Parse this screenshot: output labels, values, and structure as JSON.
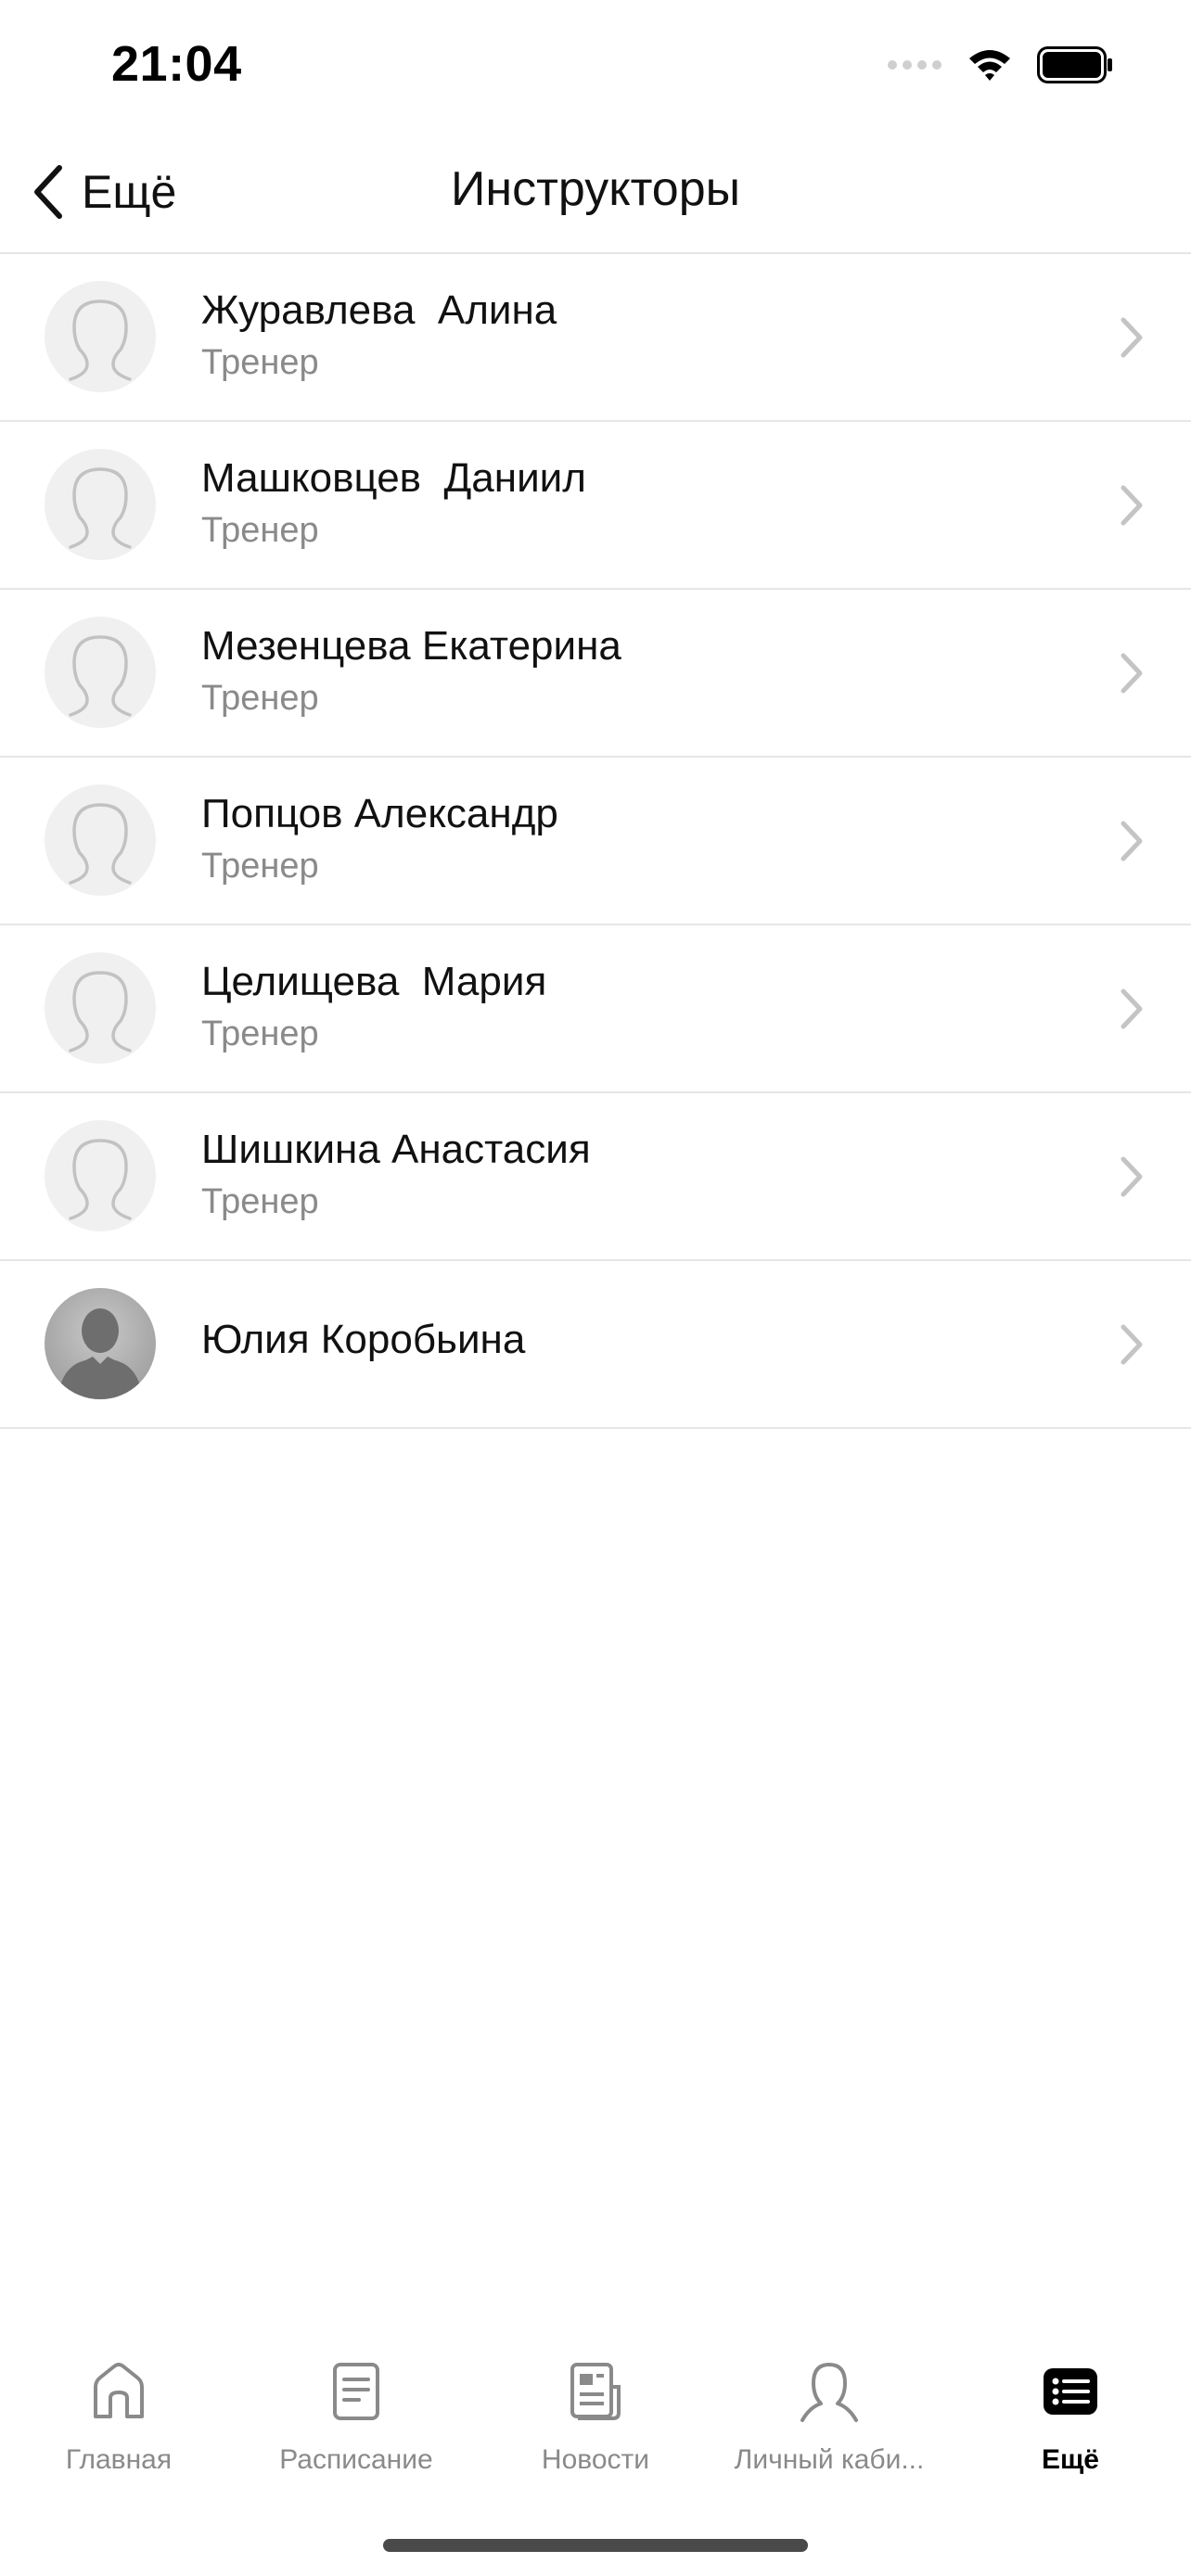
{
  "status_bar": {
    "time": "21:04"
  },
  "nav": {
    "back_label": "Ещё",
    "title": "Инструкторы"
  },
  "instructors": [
    {
      "name": "Журавлева  Алина",
      "role": "Тренер",
      "avatar": "placeholder-avatar-icon"
    },
    {
      "name": "Машковцев  Даниил",
      "role": "Тренер",
      "avatar": "placeholder-avatar-icon"
    },
    {
      "name": "Мезенцева Екатерина",
      "role": "Тренер",
      "avatar": "placeholder-avatar-icon"
    },
    {
      "name": "Попцов Александр",
      "role": "Тренер",
      "avatar": "placeholder-avatar-icon"
    },
    {
      "name": "Целищева  Мария",
      "role": "Тренер",
      "avatar": "placeholder-avatar-icon"
    },
    {
      "name": "Шишкина Анастасия",
      "role": "Тренер",
      "avatar": "placeholder-avatar-icon"
    },
    {
      "name": "Юлия Коробьина",
      "role": "",
      "avatar": "photo-avatar"
    }
  ],
  "tabs": [
    {
      "label": "Главная",
      "icon": "home-icon",
      "active": false
    },
    {
      "label": "Расписание",
      "icon": "schedule-icon",
      "active": false
    },
    {
      "label": "Новости",
      "icon": "news-icon",
      "active": false
    },
    {
      "label": "Личный каби...",
      "icon": "profile-icon",
      "active": false
    },
    {
      "label": "Ещё",
      "icon": "more-list-icon",
      "active": true
    }
  ],
  "colors": {
    "text": "#111111",
    "secondary": "#8a8a8a",
    "separator": "#e6e6e6",
    "active_tab": "#000000"
  }
}
